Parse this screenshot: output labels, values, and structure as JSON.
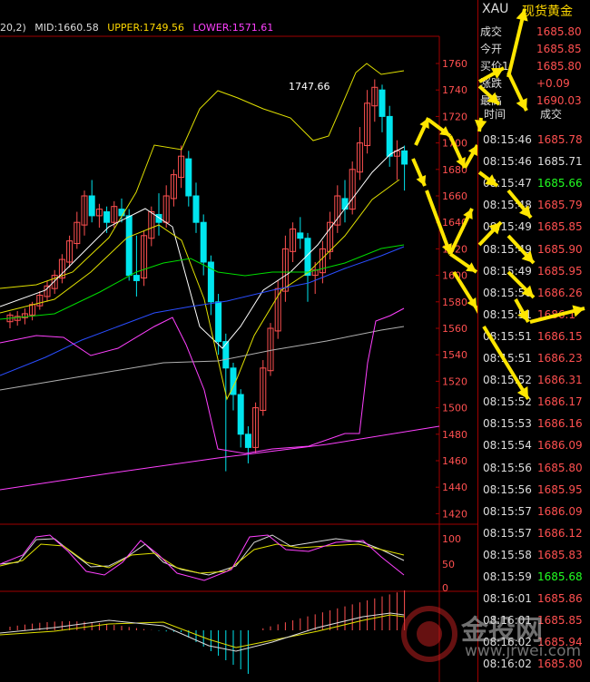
{
  "indicator_header": {
    "params": "20,2)",
    "mid": "MID:1660.58",
    "upper": "UPPER:1749.56",
    "lower": "LOWER:1571.61"
  },
  "annotation": "1747.66",
  "price_axis": [
    "1760",
    "1740",
    "1720",
    "1700",
    "1680",
    "1660",
    "1640",
    "1620",
    "1600",
    "1580",
    "1560",
    "1540",
    "1520",
    "1500",
    "1480",
    "1460",
    "1440",
    "1420"
  ],
  "osc_axis": [
    "100",
    "50",
    "0"
  ],
  "quote": {
    "symbol": "XAU",
    "name": "现货黄金",
    "rows": [
      {
        "key": "成交",
        "value": "1685.80"
      },
      {
        "key": "今开",
        "value": "1685.85"
      },
      {
        "key": "买价1",
        "value": "1685.80"
      },
      {
        "key": "涨跌",
        "value": "+0.09"
      },
      {
        "key": "最高",
        "value": "1690.03"
      }
    ]
  },
  "ticks_header": {
    "time": "时间",
    "price": "成交"
  },
  "ticks": [
    {
      "time": "08:15:46",
      "price": "1685.78",
      "color": "#ff5050"
    },
    {
      "time": "08:15:46",
      "price": "1685.71",
      "color": "#dddddd"
    },
    {
      "time": "08:15:47",
      "price": "1685.66",
      "color": "#22ff22"
    },
    {
      "time": "08:15:48",
      "price": "1685.79",
      "color": "#ff5050"
    },
    {
      "time": "08:15:49",
      "price": "1685.85",
      "color": "#ff5050"
    },
    {
      "time": "08:15:49",
      "price": "1685.90",
      "color": "#ff5050"
    },
    {
      "time": "08:15:49",
      "price": "1685.95",
      "color": "#ff5050"
    },
    {
      "time": "08:15:50",
      "price": "1686.26",
      "color": "#ff5050"
    },
    {
      "time": "08:15:51",
      "price": "1686.1",
      "color": "#ff5050"
    },
    {
      "time": "08:15:51",
      "price": "1686.15",
      "color": "#ff5050"
    },
    {
      "time": "08:15:51",
      "price": "1686.23",
      "color": "#ff5050"
    },
    {
      "time": "08:15:52",
      "price": "1686.31",
      "color": "#ff5050"
    },
    {
      "time": "08:15:52",
      "price": "1686.17",
      "color": "#ff5050"
    },
    {
      "time": "08:15:53",
      "price": "1686.16",
      "color": "#ff5050"
    },
    {
      "time": "08:15:54",
      "price": "1686.09",
      "color": "#ff5050"
    },
    {
      "time": "08:15:56",
      "price": "1685.80",
      "color": "#ff5050"
    },
    {
      "time": "08:15:56",
      "price": "1685.95",
      "color": "#ff5050"
    },
    {
      "time": "08:15:57",
      "price": "1686.09",
      "color": "#ff5050"
    },
    {
      "time": "08:15:57",
      "price": "1686.12",
      "color": "#ff5050"
    },
    {
      "time": "08:15:58",
      "price": "1685.83",
      "color": "#ff5050"
    },
    {
      "time": "08:15:59",
      "price": "1685.68",
      "color": "#22ff22"
    },
    {
      "time": "08:16:01",
      "price": "1685.86",
      "color": "#ff5050"
    },
    {
      "time": "08:16:01",
      "price": "1685.85",
      "color": "#ff5050"
    },
    {
      "time": "08:16:02",
      "price": "1685.94",
      "color": "#ff5050"
    },
    {
      "time": "08:16:02",
      "price": "1685.80",
      "color": "#ff5050"
    }
  ],
  "watermark": {
    "brand": "金投网",
    "url": "www.jrwei.com"
  },
  "colors": {
    "up": "#ff5050",
    "down": "#00e5ee",
    "accent": "#ffd800",
    "grid": "#a00000"
  }
}
